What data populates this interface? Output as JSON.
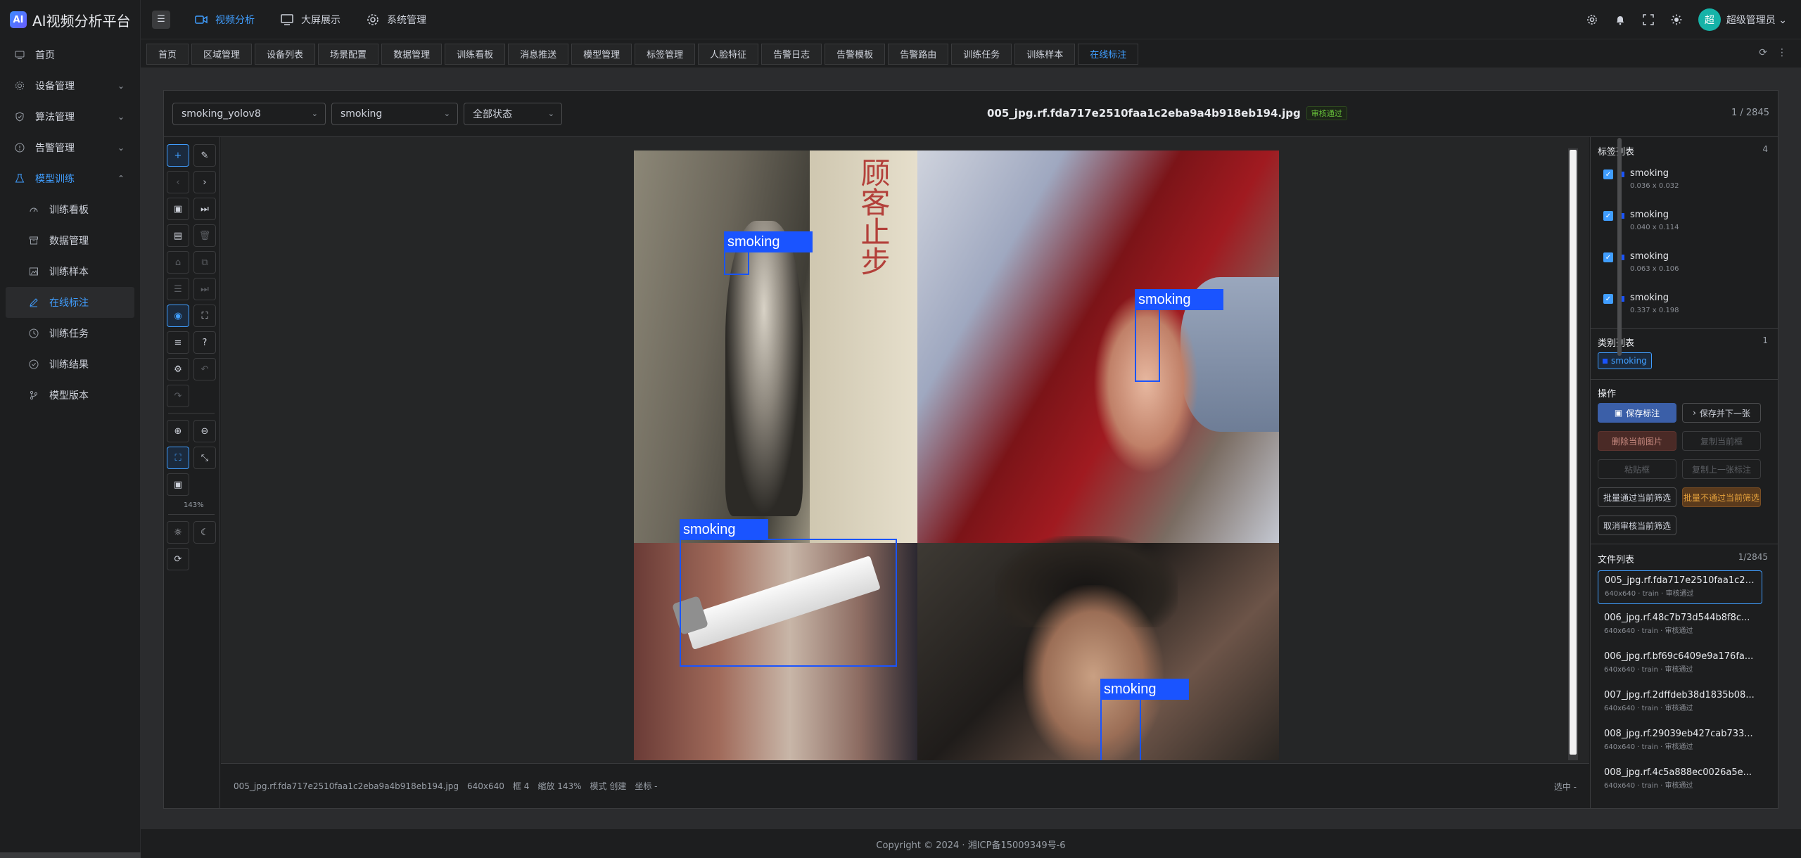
{
  "app": {
    "title": "AI视频分析平台",
    "logo_glyph": "AI"
  },
  "sidebar": {
    "items": [
      {
        "label": "首页",
        "icon": "monitor-icon"
      },
      {
        "label": "设备管理",
        "icon": "gear-icon"
      },
      {
        "label": "算法管理",
        "icon": "shield-icon"
      },
      {
        "label": "告警管理",
        "icon": "info-icon"
      },
      {
        "label": "模型训练",
        "icon": "flask-icon"
      }
    ],
    "subitems": [
      {
        "label": "训练看板"
      },
      {
        "label": "数据管理"
      },
      {
        "label": "训练样本"
      },
      {
        "label": "在线标注"
      },
      {
        "label": "训练任务"
      },
      {
        "label": "训练结果"
      },
      {
        "label": "模型版本"
      }
    ]
  },
  "header": {
    "nav": [
      {
        "label": "视频分析",
        "icon": "video-icon"
      },
      {
        "label": "大屏展示",
        "icon": "monitor-icon"
      },
      {
        "label": "系统管理",
        "icon": "gear-icon"
      }
    ],
    "avatar_text": "超",
    "user_name": "超级管理员"
  },
  "tabs": [
    "首页",
    "区域管理",
    "设备列表",
    "场景配置",
    "数据管理",
    "训练看板",
    "消息推送",
    "模型管理",
    "标签管理",
    "人脸特征",
    "告警日志",
    "告警模板",
    "告警路由",
    "训练任务",
    "训练样本",
    "在线标注"
  ],
  "toolbar": {
    "model_select": "smoking_yolov8",
    "label_select": "smoking",
    "status_select": "全部状态",
    "file_title": "005_jpg.rf.fda717e2510faa1c2eba9a4b918eb194.jpg",
    "review_badge": "审核通过",
    "page_count": "1 / 2845"
  },
  "tools": {
    "zoom_label": "143%"
  },
  "canvas": {
    "image_chars": "顾客止步",
    "box_labels": [
      "smoking",
      "smoking",
      "smoking",
      "smoking"
    ]
  },
  "status_bar": {
    "file": "005_jpg.rf.fda717e2510faa1c2eba9a4b918eb194.jpg",
    "dims": "640x640",
    "boxes": "框 4",
    "zoom": "缩放 143%",
    "mode": "模式 创建",
    "coords": "坐标 -",
    "selected": "选中 -"
  },
  "right_panel": {
    "labels_title": "标签列表",
    "labels_count": "4",
    "labels": [
      {
        "name": "smoking",
        "size": "0.036 x 0.032"
      },
      {
        "name": "smoking",
        "size": "0.040 x 0.114"
      },
      {
        "name": "smoking",
        "size": "0.063 x 0.106"
      },
      {
        "name": "smoking",
        "size": "0.337 x 0.198"
      }
    ],
    "categories_title": "类别列表",
    "categories_count": "1",
    "category": "smoking",
    "ops_title": "操作",
    "ops": {
      "save": "保存标注",
      "save_next": "保存并下一张",
      "delete_image": "删除当前图片",
      "copy_box": "复制当前框",
      "paste_box": "粘贴框",
      "copy_prev": "复制上一张标注",
      "batch_pass": "批量通过当前筛选",
      "batch_fail": "批量不通过当前筛选",
      "cancel_review": "取消审核当前筛选"
    },
    "files_title": "文件列表",
    "files_count": "1/2845",
    "files": [
      {
        "name": "005_jpg.rf.fda717e2510faa1c2e...",
        "meta": "640x640 · train · 审核通过"
      },
      {
        "name": "006_jpg.rf.48c7b73d544b8f8c...",
        "meta": "640x640 · train · 审核通过"
      },
      {
        "name": "006_jpg.rf.bf69c6409e9a176fa...",
        "meta": "640x640 · train · 审核通过"
      },
      {
        "name": "007_jpg.rf.2dffdeb38d1835b08...",
        "meta": "640x640 · train · 审核通过"
      },
      {
        "name": "008_jpg.rf.29039eb427cab733...",
        "meta": "640x640 · train · 审核通过"
      },
      {
        "name": "008_jpg.rf.4c5a888ec0026a5e...",
        "meta": "640x640 · train · 审核通过"
      }
    ]
  },
  "footer": {
    "text": "Copyright © 2024 · 湘ICP备15009349号-6"
  }
}
